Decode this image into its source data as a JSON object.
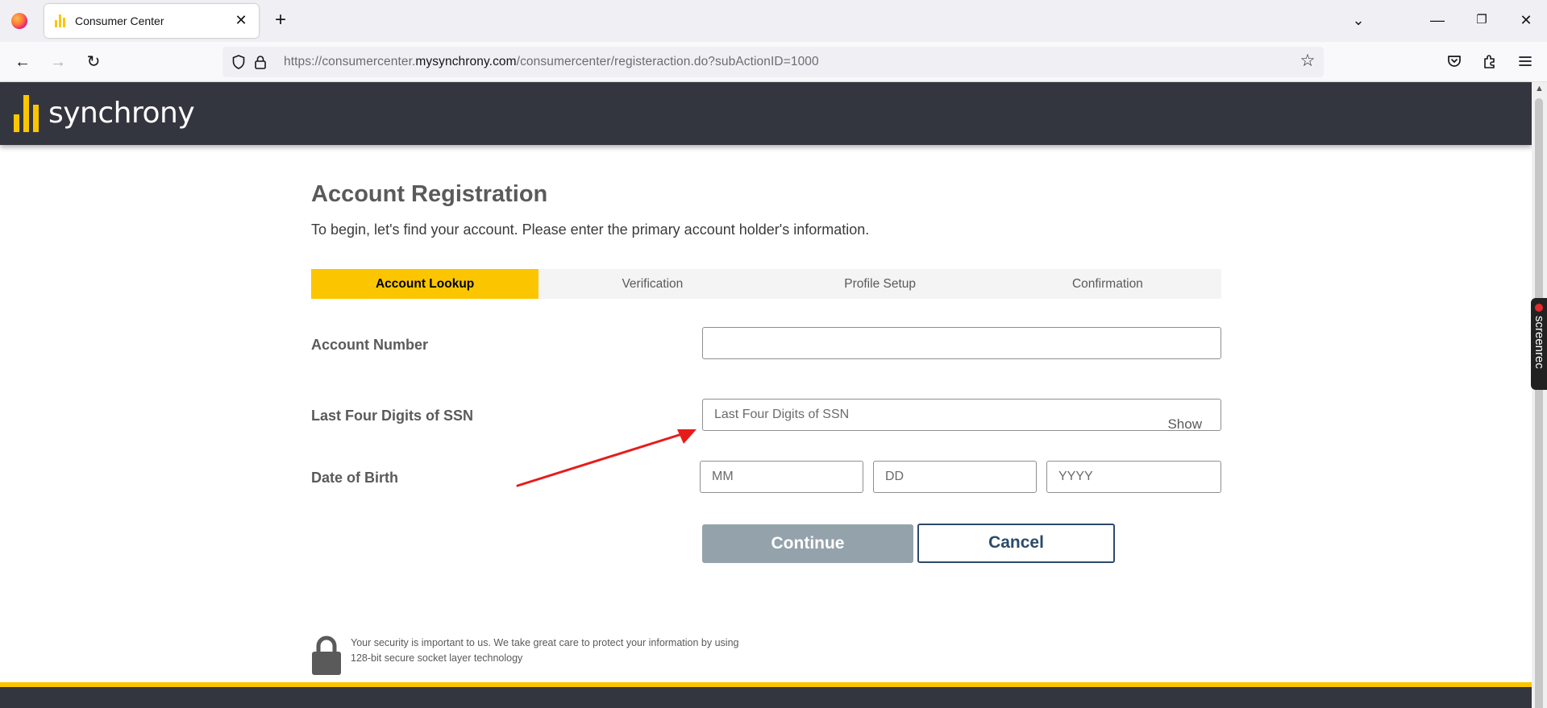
{
  "browser": {
    "tab_title": "Consumer Center",
    "tab_close": "✕",
    "new_tab": "+",
    "url_prefix": "https://consumercenter.",
    "url_domain": "mysynchrony.com",
    "url_path": "/consumercenter/registeraction.do?subActionID=1000",
    "window_controls": {
      "minimize": "—",
      "restore": "❐",
      "close": "✕",
      "list_all_tabs": "⌄"
    },
    "nav": {
      "back": "←",
      "forward": "→",
      "reload": "↻",
      "bookmark": "☆"
    }
  },
  "site": {
    "logo_text": "synchrony",
    "brand_color": "#fbc600",
    "header_color": "#34363f"
  },
  "page": {
    "title": "Account Registration",
    "subtitle": "To begin, let's find your account. Please enter the primary account holder's information."
  },
  "steps": [
    {
      "label": "Account Lookup",
      "active": true
    },
    {
      "label": "Verification",
      "active": false
    },
    {
      "label": "Profile Setup",
      "active": false
    },
    {
      "label": "Confirmation",
      "active": false
    }
  ],
  "form": {
    "account_number": {
      "label": "Account Number",
      "value": "",
      "placeholder": ""
    },
    "ssn": {
      "label": "Last Four Digits of SSN",
      "placeholder": "Last Four Digits of SSN",
      "show_label": "Show"
    },
    "dob": {
      "label": "Date of Birth",
      "month_placeholder": "MM",
      "day_placeholder": "DD",
      "year_placeholder": "YYYY"
    },
    "continue_label": "Continue",
    "cancel_label": "Cancel"
  },
  "security": {
    "text": "Your security is important to us. We take great care to protect your information by using 128-bit secure socket layer technology"
  },
  "overlay": {
    "screenrec_label": "screenrec",
    "annotation_arrow_color": "#e81b1b"
  }
}
